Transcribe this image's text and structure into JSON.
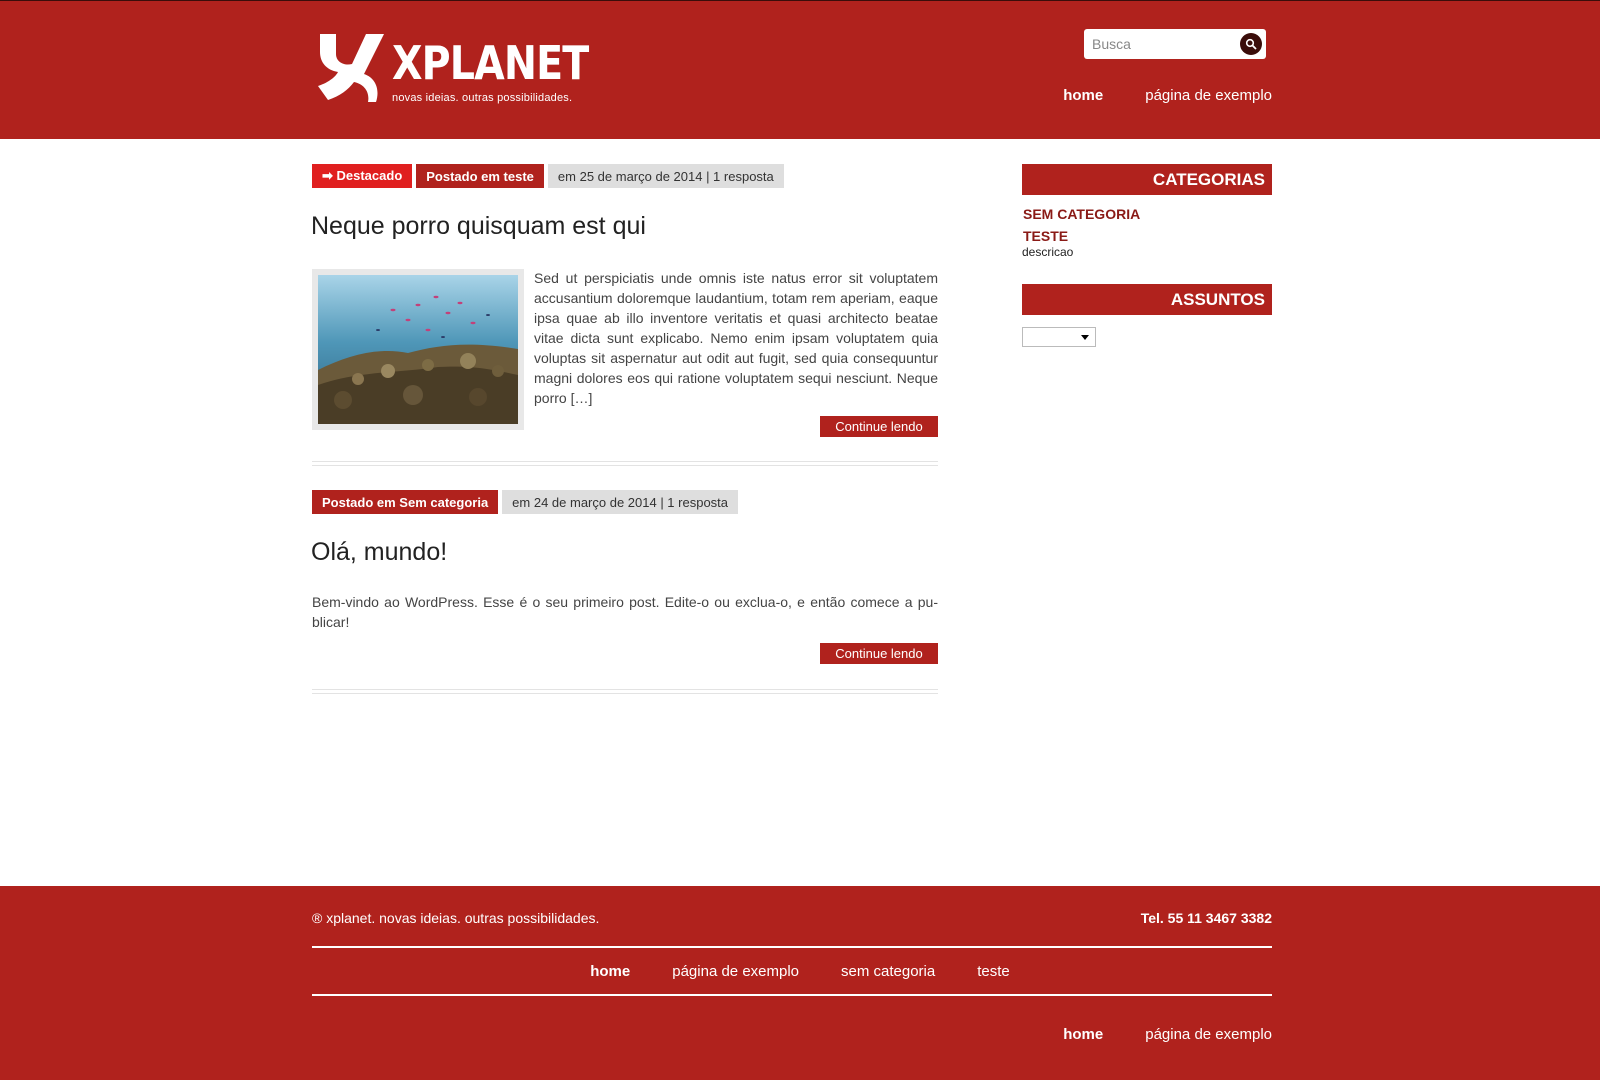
{
  "header": {
    "logo_name": "XPLANET",
    "logo_tagline": "novas ideias. outras possibilidades.",
    "search_placeholder": "Busca",
    "nav": [
      {
        "label": "home",
        "active": true
      },
      {
        "label": "página de exemplo",
        "active": false
      }
    ]
  },
  "posts": [
    {
      "featured_label": "➡ Destacado",
      "category_label": "Postado em teste",
      "date_meta": "em 25 de março de 2014 | 1 resposta",
      "title": "Neque porro quisquam est qui",
      "excerpt": "Sed ut perspiciatis unde omnis iste natus error sit voluptatem accusantium doloremque laudantium, totam rem aperiam, eaque ipsa quae ab illo inventore veritatis et quasi architecto beatae vitae dicta sunt explicabo. Nemo enim ipsam volupta­tem quia voluptas sit aspernatur aut odit aut fugit, sed quia consequuntur magni dolores eos qui ratione voluptatem se­qui nesciunt. Neque porro […]",
      "more_label": "Continue lendo"
    },
    {
      "category_label": "Postado em Sem categoria",
      "date_meta": "em 24 de março de 2014 | 1 resposta",
      "title": "Olá, mundo!",
      "excerpt": "Bem-vindo ao WordPress. Esse é o seu primeiro post. Edite-o ou exclua-o, e então comece a pu­blicar!",
      "more_label": "Continue lendo"
    }
  ],
  "sidebar": {
    "categories_title": "CATEGORIAS",
    "categories": [
      {
        "label": "SEM CATEGORIA",
        "description": ""
      },
      {
        "label": "TESTE",
        "description": "descricao"
      }
    ],
    "topics_title": "ASSUNTOS",
    "topics_selected": ""
  },
  "footer": {
    "copyright": "® xplanet. novas ideias. outras possibilidades.",
    "phone": "Tel. 55 11 3467 3382",
    "nav": [
      {
        "label": "home",
        "active": true
      },
      {
        "label": "página de exemplo",
        "active": false
      },
      {
        "label": "sem categoria",
        "active": false
      },
      {
        "label": "teste",
        "active": false
      }
    ],
    "nav2": [
      {
        "label": "home",
        "active": true
      },
      {
        "label": "página de exemplo",
        "active": false
      }
    ]
  },
  "colors": {
    "brand_red": "#b0221d",
    "featured_red": "#e01f1f",
    "meta_gray": "#dedede",
    "category_link": "#8a1a16"
  }
}
